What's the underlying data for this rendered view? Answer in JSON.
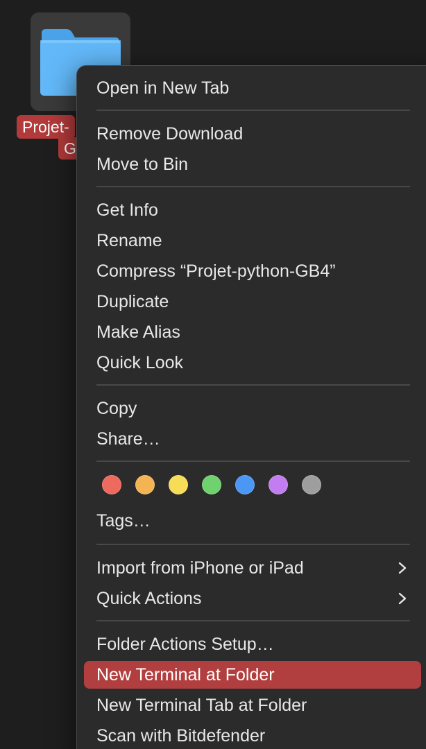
{
  "desktop": {
    "folder_label_line1": "Projet-",
    "folder_label_line2": "G"
  },
  "menu": {
    "items": {
      "open_new_tab": "Open in New Tab",
      "remove_download": "Remove Download",
      "move_to_bin": "Move to Bin",
      "get_info": "Get Info",
      "rename": "Rename",
      "compress": "Compress “Projet-python-GB4”",
      "duplicate": "Duplicate",
      "make_alias": "Make Alias",
      "quick_look": "Quick Look",
      "copy": "Copy",
      "share": "Share…",
      "tags": "Tags…",
      "import_iphone": "Import from iPhone or iPad",
      "quick_actions": "Quick Actions",
      "folder_actions_setup": "Folder Actions Setup…",
      "new_terminal": "New Terminal at Folder",
      "new_terminal_tab": "New Terminal Tab at Folder",
      "scan_bitdefender": "Scan with Bitdefender"
    },
    "highlighted_item": "New Terminal at Folder",
    "tag_colors": [
      "#ee6a5f",
      "#f5b453",
      "#f7dc57",
      "#6fd26f",
      "#4b97f5",
      "#c27ef0",
      "#9e9e9e"
    ]
  },
  "colors": {
    "highlight": "#b23f3f",
    "menu_background": "#2b2b2b",
    "folder_blue": "#5cb6f7"
  }
}
